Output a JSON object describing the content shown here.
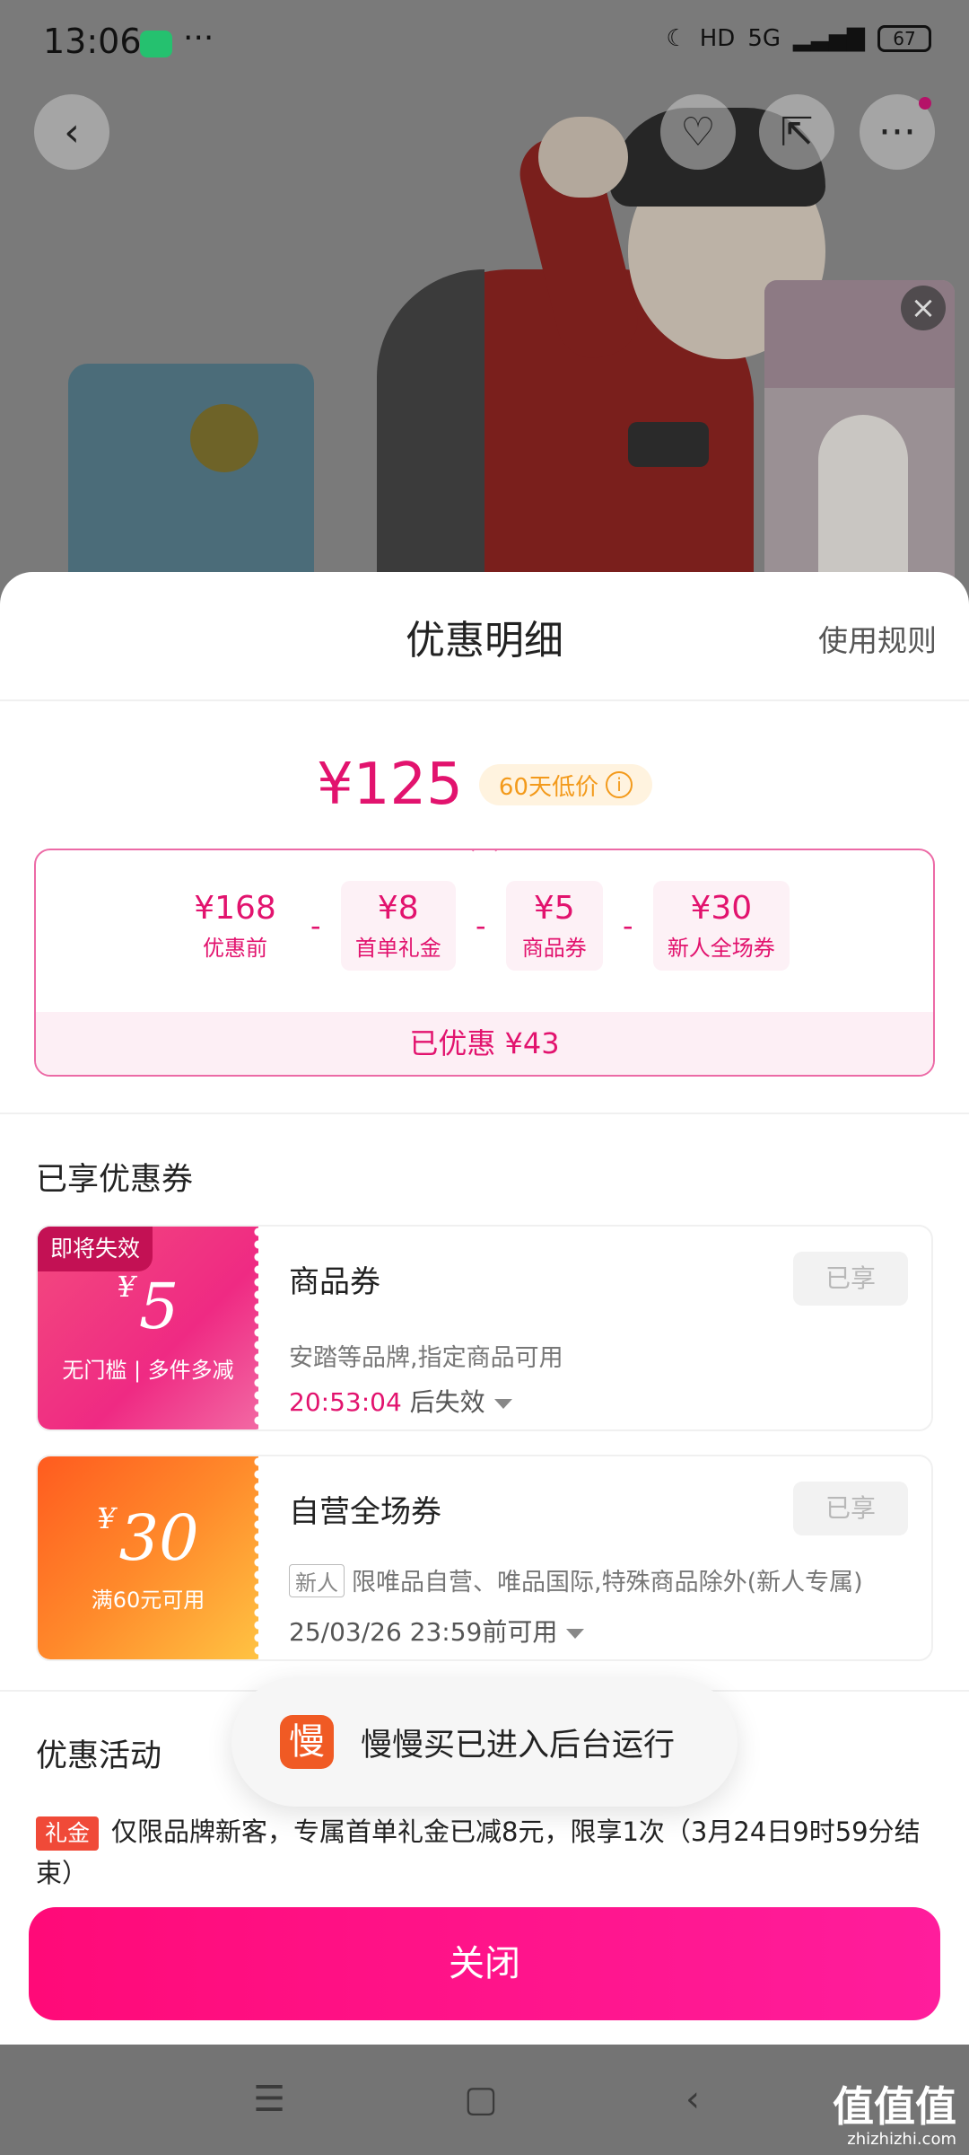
{
  "status_bar": {
    "time": "13:06",
    "dots": "···",
    "hd": "HD",
    "network": "5G",
    "battery": "67"
  },
  "sheet": {
    "title": "优惠明细",
    "rules_link": "使用规则",
    "price": "¥125",
    "low_price_badge": "60天低价",
    "calc": [
      {
        "value": "¥168",
        "label": "优惠前"
      },
      {
        "value": "¥8",
        "label": "首单礼金"
      },
      {
        "value": "¥5",
        "label": "商品券"
      },
      {
        "value": "¥30",
        "label": "新人全场券"
      }
    ],
    "minus": "-",
    "saved": "已优惠 ¥43"
  },
  "coupons_section": {
    "title": "已享优惠券"
  },
  "coupons": [
    {
      "tag": "即将失效",
      "yen": "¥",
      "amount": "5",
      "condition": "无门槛 | 多件多减",
      "name": "商品券",
      "status": "已享",
      "desc": "安踏等品牌,指定商品可用",
      "countdown": "20:53:04",
      "countdown_suffix": " 后失效"
    },
    {
      "yen": "¥",
      "amount": "30",
      "condition": "满60元可用",
      "name": "自营全场券",
      "status": "已享",
      "new_tag": "新人",
      "desc": "限唯品自营、唯品国际,特殊商品除外(新人专属)",
      "time": "25/03/26 23:59前可用"
    }
  ],
  "activity_section": {
    "title": "优惠活动",
    "tag": "礼金",
    "text": "仅限品牌新客，专属首单礼金已减8元，限享1次（3月24日9时59分结束）"
  },
  "toast": {
    "icon": "慢",
    "text": "慢慢买已进入后台运行"
  },
  "close_button": "关闭",
  "watermark": {
    "main": "值值值",
    "sub": "zhizhizhi.com"
  }
}
